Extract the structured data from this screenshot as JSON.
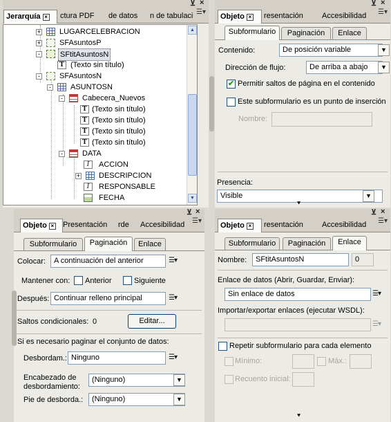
{
  "ui": {
    "close_glyph": "×",
    "collapse_glyph": "⊻",
    "dropdown_glyph": "▼",
    "menu_glyph": "☰▾",
    "check_glyph": "✔"
  },
  "hier": {
    "tabs": [
      "Jerarquía",
      "ctura PDF",
      "de datos",
      "n de tabulaci"
    ],
    "tree": [
      {
        "label": "LUGARCELEBRACION",
        "icon": "table-icon",
        "expander": "+"
      },
      {
        "label": "SFAsuntosP",
        "icon": "subform-icon",
        "expander": "+"
      },
      {
        "label": "SFtitAsuntosN",
        "icon": "subform-icon",
        "expander": "-",
        "selected": true
      },
      {
        "label": "(Texto sin título)",
        "icon": "text-icon",
        "expander": ""
      },
      {
        "label": "SFAsuntosN",
        "icon": "subform-icon",
        "expander": "-"
      },
      {
        "label": "ASUNTOSN",
        "icon": "table-icon",
        "expander": "-"
      },
      {
        "label": "Cabecera_Nuevos",
        "icon": "table-header-icon",
        "expander": "-"
      },
      {
        "label": "(Texto sin título)",
        "icon": "text-icon",
        "expander": ""
      },
      {
        "label": "(Texto sin título)",
        "icon": "text-icon",
        "expander": ""
      },
      {
        "label": "(Texto sin título)",
        "icon": "text-icon",
        "expander": ""
      },
      {
        "label": "(Texto sin título)",
        "icon": "text-icon",
        "expander": ""
      },
      {
        "label": "DATA",
        "icon": "table-header-icon",
        "expander": "-"
      },
      {
        "label": "ACCION",
        "icon": "field-icon",
        "expander": ""
      },
      {
        "label": "DESCRIPCION",
        "icon": "table-icon",
        "expander": "+"
      },
      {
        "label": "RESPONSABLE",
        "icon": "field-icon",
        "expander": ""
      },
      {
        "label": "FECHA",
        "icon": "image-field-icon",
        "expander": ""
      }
    ]
  },
  "p1": {
    "tabs": [
      "Objeto",
      "resentación",
      "Accesibilidad"
    ],
    "subtabs": [
      "Subformulario",
      "Paginación",
      "Enlace"
    ],
    "contenido_label": "Contenido:",
    "contenido_value": "De posición variable",
    "direccion_label": "Dirección de flujo:",
    "direccion_value": "De arriba a abajo",
    "permitir_label": "Permitir saltos de página en el contenido",
    "permitir_checked": true,
    "insercion_label": "Este subformulario es un punto de inserción",
    "insercion_checked": false,
    "nombre_label": "Nombre:",
    "nombre_value": "",
    "presencia_label": "Presencia:",
    "presencia_value": "Visible"
  },
  "p2": {
    "tabs": [
      "Objeto",
      "Presentación",
      "rde",
      "Accesibilidad"
    ],
    "subtabs": [
      "Subformulario",
      "Paginación",
      "Enlace"
    ],
    "colocar_label": "Colocar:",
    "colocar_value": "A continuación del anterior",
    "mantener_label": "Mantener con:",
    "anterior_label": "Anterior",
    "siguiente_label": "Siguiente",
    "despues_label": "Después:",
    "despues_value": "Continuar relleno principal",
    "saltos_label": "Saltos condicionales:",
    "saltos_count": "0",
    "editar_label": "Editar...",
    "paginar_label": "Si es necesario paginar el conjunto de datos:",
    "desbordam_label": "Desbordam.:",
    "desbordam_value": "Ninguno",
    "encabezado_label_1": "Encabezado de",
    "encabezado_label_2": "desbordamiento:",
    "encabezado_value": "(Ninguno)",
    "pie_label": "Pie de desborda.:",
    "pie_value": "(Ninguno)"
  },
  "p3": {
    "tabs": [
      "Objeto",
      "resentación",
      "Accesibilidad"
    ],
    "subtabs": [
      "Subformulario",
      "Paginación",
      "Enlace"
    ],
    "nombre_label": "Nombre:",
    "nombre_value": "SFtitAsuntosN",
    "index_value": "0",
    "enlace_label": "Enlace de datos (Abrir, Guardar, Enviar):",
    "enlace_value": "Sin enlace de datos",
    "importar_label": "Importar/exportar enlaces (ejecutar WSDL):",
    "importar_value": "",
    "repetir_label": "Repetir subformulario para cada elemento",
    "minimo_label": "Mínimo:",
    "maximo_label": "Máx.:",
    "recuento_label": "Recuento inicial:"
  }
}
